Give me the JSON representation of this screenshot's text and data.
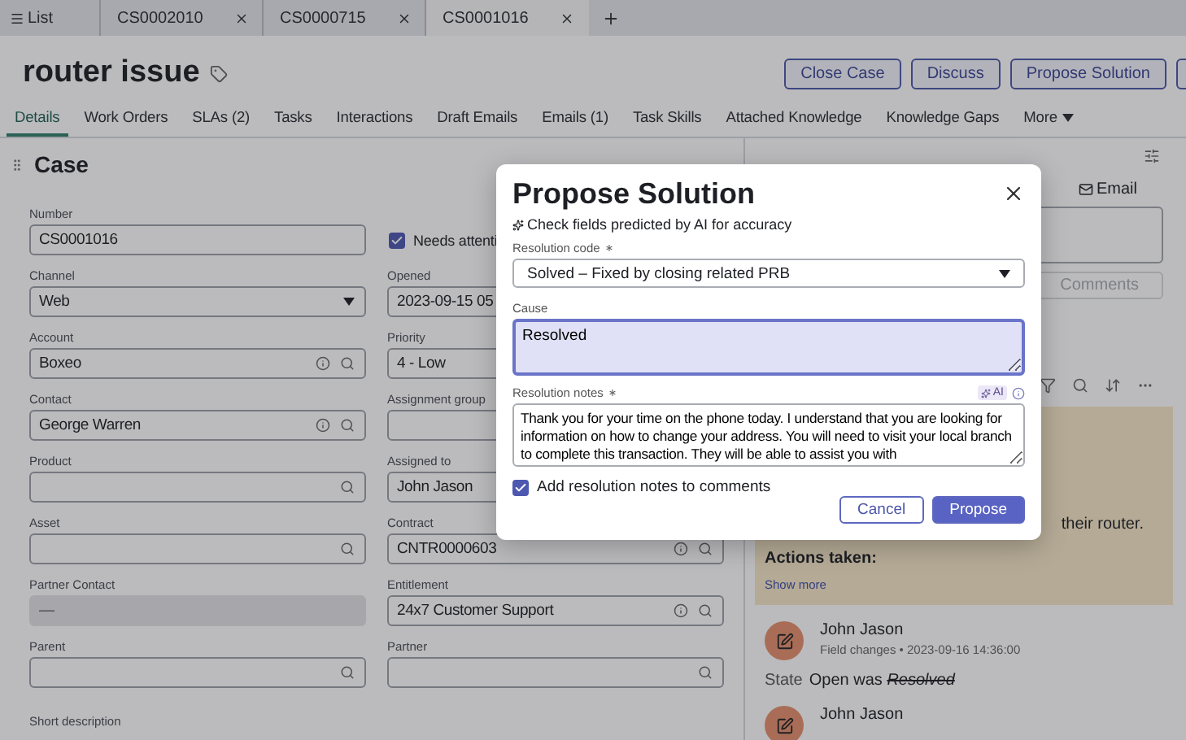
{
  "browser_tabs": [
    {
      "label": "List",
      "kind": "list",
      "selected": false
    },
    {
      "label": "CS0002010",
      "kind": "record",
      "selected": false
    },
    {
      "label": "CS0000715",
      "kind": "record",
      "selected": false
    },
    {
      "label": "CS0001016",
      "kind": "record",
      "selected": true
    }
  ],
  "record": {
    "title": "router issue",
    "actions": [
      "Close Case",
      "Discuss",
      "Propose Solution"
    ]
  },
  "tabs": [
    {
      "label": "Details",
      "selected": true,
      "kind": "tab"
    },
    {
      "label": "Work Orders",
      "selected": false,
      "kind": "tab"
    },
    {
      "label": "SLAs (2)",
      "selected": false,
      "kind": "tab"
    },
    {
      "label": "Tasks",
      "selected": false,
      "kind": "tab"
    },
    {
      "label": "Interactions",
      "selected": false,
      "kind": "tab"
    },
    {
      "label": "Draft Emails",
      "selected": false,
      "kind": "tab"
    },
    {
      "label": "Emails (1)",
      "selected": false,
      "kind": "tab"
    },
    {
      "label": "Task Skills",
      "selected": false,
      "kind": "tab"
    },
    {
      "label": "Attached Knowledge",
      "selected": false,
      "kind": "tab"
    },
    {
      "label": "Knowledge Gaps",
      "selected": false,
      "kind": "tab"
    },
    {
      "label": "More",
      "selected": false,
      "kind": "menu"
    }
  ],
  "form": {
    "title": "Case",
    "fields": [
      {
        "label": "Number",
        "value": "CS0001016",
        "kind": "text"
      },
      {
        "label": "Needs attenti",
        "kind": "checkbox",
        "checked": true
      },
      {
        "label": "Channel",
        "value": "Web",
        "kind": "select"
      },
      {
        "label": "Opened",
        "value": "2023-09-15 05",
        "kind": "text"
      },
      {
        "label": "Account",
        "value": "Boxeo",
        "kind": "lookup",
        "info": true
      },
      {
        "label": "Priority",
        "value": "4 - Low",
        "kind": "text"
      },
      {
        "label": "Contact",
        "value": "George Warren",
        "kind": "lookup",
        "info": true
      },
      {
        "label": "Assignment group",
        "kind": "text"
      },
      {
        "label": "Product",
        "kind": "lookup",
        "info": false
      },
      {
        "label": "Assigned to",
        "value": "John Jason",
        "kind": "text"
      },
      {
        "label": "Asset",
        "kind": "lookup",
        "info": false
      },
      {
        "label": "Contract",
        "value": "CNTR0000603",
        "kind": "lookup",
        "info": true
      },
      {
        "label": "Partner Contact",
        "value": "—",
        "kind": "readonly"
      },
      {
        "label": "Entitlement",
        "value": "24x7 Customer Support",
        "kind": "lookup",
        "info": true
      },
      {
        "label": "Parent",
        "kind": "lookup",
        "info": false
      },
      {
        "label": "Partner",
        "kind": "lookup",
        "info": false
      },
      {
        "label": "Short description",
        "kind": "label"
      }
    ]
  },
  "activity": {
    "compose_button": "Email",
    "comment_button": "Comments",
    "card": {
      "text": "their router.",
      "heading": "Actions taken:",
      "link": "Show more"
    },
    "entries": [
      {
        "author": "John Jason",
        "meta": "Field changes • 2023-09-16 14:36:00",
        "field": "State",
        "new_value": "Open",
        "was": "was",
        "old_value": "Resolved"
      },
      {
        "author": "John Jason"
      }
    ]
  },
  "dialog": {
    "title": "Propose Solution",
    "ai_hint": "Check fields predicted by AI for accuracy",
    "resolution_code": {
      "label": "Resolution code",
      "required": true,
      "value": "Solved – Fixed by closing related PRB"
    },
    "cause": {
      "label": "Cause",
      "value": "Resolved",
      "focused": true
    },
    "resolution_notes": {
      "label": "Resolution notes",
      "required": true,
      "ai_badge": "AI",
      "value": "Thank you for your time on the phone today. I understand that you are looking for information on how to change your address. You will need to visit your local branch to complete this transaction. They will be able to assist you with"
    },
    "add_to_comments": {
      "label": "Add resolution notes to comments",
      "checked": true
    },
    "buttons": [
      {
        "label": "Cancel",
        "kind": "secondary"
      },
      {
        "label": "Propose",
        "kind": "primary"
      }
    ]
  }
}
